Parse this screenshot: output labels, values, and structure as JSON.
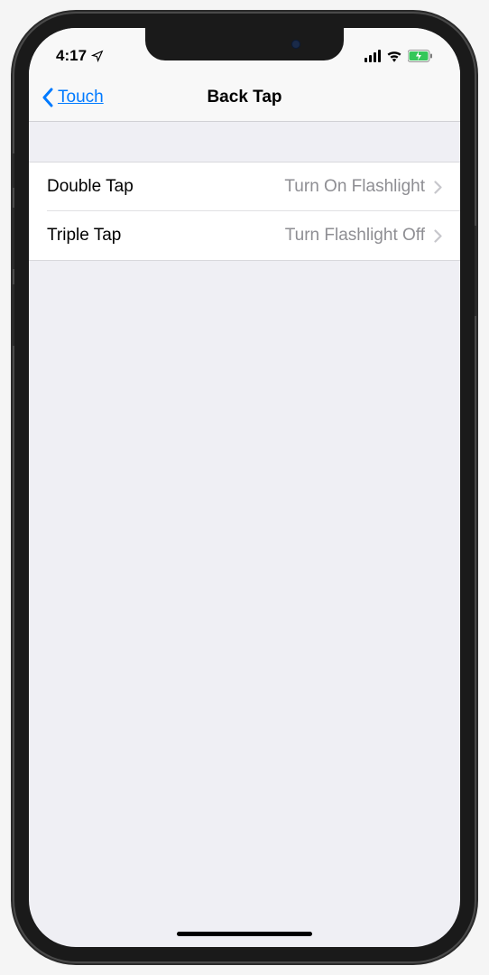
{
  "status": {
    "time": "4:17"
  },
  "nav": {
    "back_label": "Touch",
    "title": "Back Tap"
  },
  "rows": [
    {
      "label": "Double Tap",
      "value": "Turn On Flashlight"
    },
    {
      "label": "Triple Tap",
      "value": "Turn Flashlight Off"
    }
  ]
}
